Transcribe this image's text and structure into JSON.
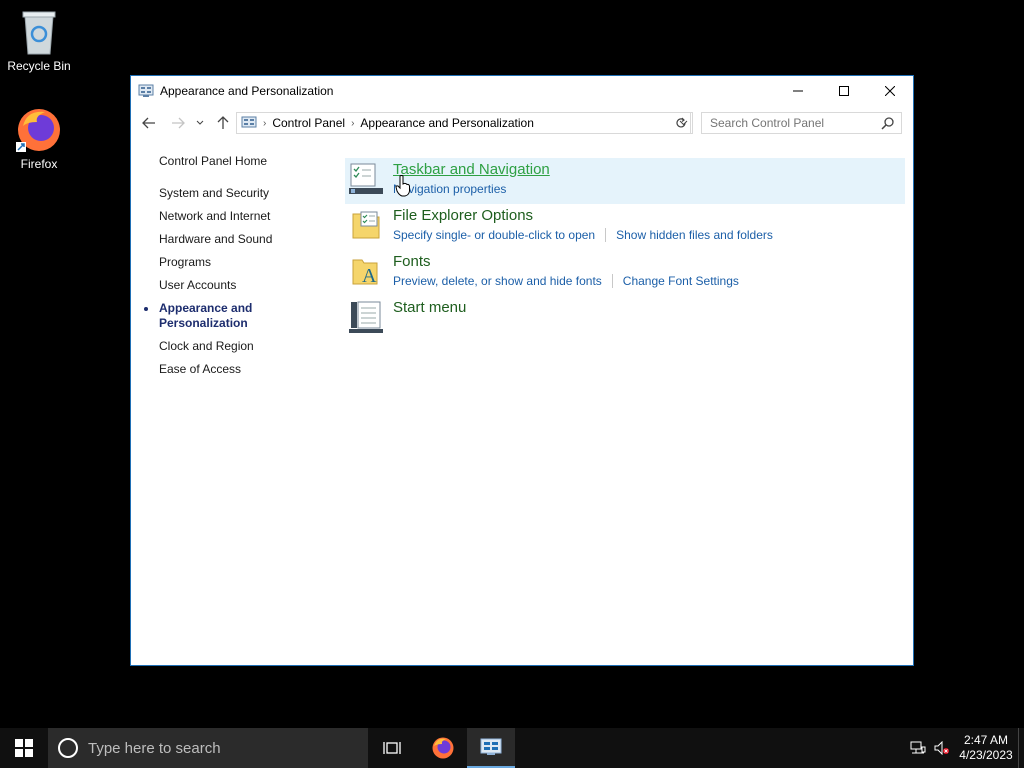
{
  "desktop": {
    "recycle_bin": "Recycle Bin",
    "firefox": "Firefox"
  },
  "window": {
    "title": "Appearance and Personalization",
    "breadcrumb": [
      "Control Panel",
      "Appearance and Personalization"
    ],
    "search_placeholder": "Search Control Panel"
  },
  "leftnav": {
    "home": "Control Panel Home",
    "items": [
      "System and Security",
      "Network and Internet",
      "Hardware and Sound",
      "Programs",
      "User Accounts",
      "Appearance and Personalization",
      "Clock and Region",
      "Ease of Access"
    ]
  },
  "categories": [
    {
      "title": "Taskbar and Navigation",
      "links": [
        "Navigation properties"
      ]
    },
    {
      "title": "File Explorer Options",
      "links": [
        "Specify single- or double-click to open",
        "Show hidden files and folders"
      ]
    },
    {
      "title": "Fonts",
      "links": [
        "Preview, delete, or show and hide fonts",
        "Change Font Settings"
      ]
    },
    {
      "title": "Start menu",
      "links": []
    }
  ],
  "taskbar": {
    "search_placeholder": "Type here to search",
    "time": "2:47 AM",
    "date": "4/23/2023"
  },
  "colors": {
    "accent": "#1f6fb5",
    "link": "#1c5fa8",
    "category_title": "#1e5e1e",
    "hover_bg": "#e5f3fb"
  }
}
